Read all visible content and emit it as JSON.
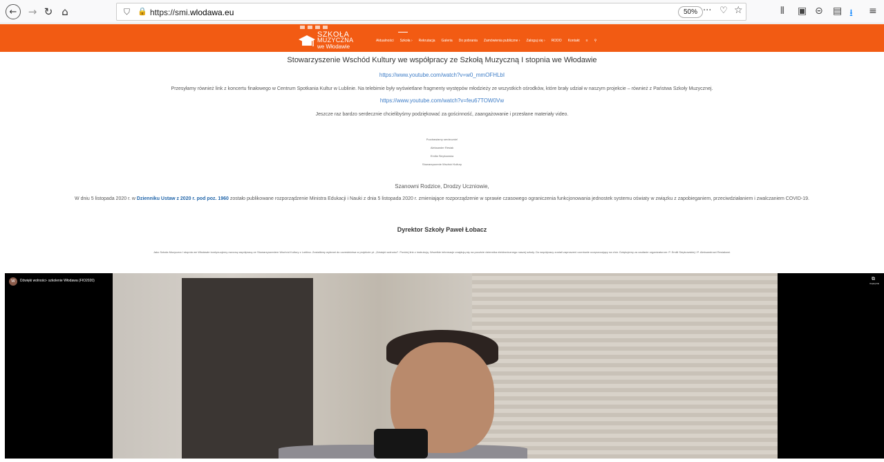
{
  "browser": {
    "url_prefix": "https://smi.",
    "url_host": "wlodawa.eu",
    "zoom": "50%",
    "icons": {
      "back": "←",
      "forward": "→",
      "reload": "↻",
      "home": "⌂",
      "shield": "⛉",
      "lock": "🔒",
      "more": "···",
      "pocket": "♡",
      "star": "☆",
      "library": "⫴",
      "reader": "▣",
      "account": "⊝",
      "extension": "▤",
      "download": "⭳",
      "menu": "≡"
    }
  },
  "site": {
    "logo_line1": "SZKOŁA",
    "logo_line2": "MUZYCZNA",
    "logo_line3": "we Włodawie",
    "nav": [
      "Aktualności",
      "Szkoła ›",
      "Rekrutacja",
      "Galeria",
      "Do pobrania",
      "Zamówienia publiczne ›",
      "Zaloguj się ›",
      "RODO",
      "Kontakt",
      "≡",
      "⚲"
    ]
  },
  "content": {
    "heading_assoc": "Stowarzyszenie Wschód Kultury we współpracy ze Szkołą Muzyczną I stopnia we Włodawie",
    "link1": "https://www.youtube.com/watch?v=w0_mmOFHLbI",
    "p_also": "Przesyłamy również link z koncertu finałowego w Centrum Spotkania Kultur w Lublinie. Na telebimie były wyświetlane fragmenty występów młodzieży ze wszystkich ośrodków, które brały udział w naszym projekcie – również z Państwa Szkoły Muzycznej.",
    "link2": "https://www.youtube.com/watch?v=feu67TOW0Vw",
    "p_thanks": "Jeszcze raz bardzo serdecznie chcielibyśmy podziękować za gościnność, zaangażowanie i przesłane materiały video.",
    "sig1": "Pozdrawiamy serdecznie!",
    "sig2": "Aleksander Resiak",
    "sig3": "Emilia Siepkowska",
    "sig4": "Stowarzyszenie Wschód Kultury",
    "p_parents": "Szanowni Rodzice, Drodzy Uczniowie,",
    "p_law_before": "W dniu 5 listopada 2020 r. w ",
    "p_law_link": "Dzienniku Ustaw z 2020 r. pod poz. 1960",
    "p_law_after": " zostało publikowane rozporządzenie Ministra Edukacji i Nauki z dnia 5 listopada 2020 r. zmieniające rozporządzenie w sprawie czasowego ograniczenia funkcjonowania jednostek systemu oświaty w związku z zapobieganiem, przeciwdziałaniem i zwalczaniem COVID-19.",
    "p_director": "Dyrektor Szkoły Paweł Łobacz",
    "p_school": "Jako Szkoła Muzyczna I stopnia we Włodawie kontynuujemy owocną współpracę ze Stowarzyszeniem Wschód Kultury z Lublina. Zostaliśmy wybrani do uczestnictwa w projekcie pt. „Dźwięki wolności\". Poniżej link z instrukcją. Wszelkie informacje znajdują się na pocztcie dziennika elektronicznego naszej szkoły. Do współpracy zostali zaproszeni uczniowie uczęszczający na chór. Dziękujemy za zaufanie organizatorom: P. Emilii Siepkowskiej i P. Aleksandrowi Resiakowi."
  },
  "video": {
    "avatar_letter": "W",
    "title": "Dźwięki wolności- szkolenie Włodawa (FIO2020)",
    "copy_icon": "⧉",
    "copy_label": "Kopiuj link"
  }
}
